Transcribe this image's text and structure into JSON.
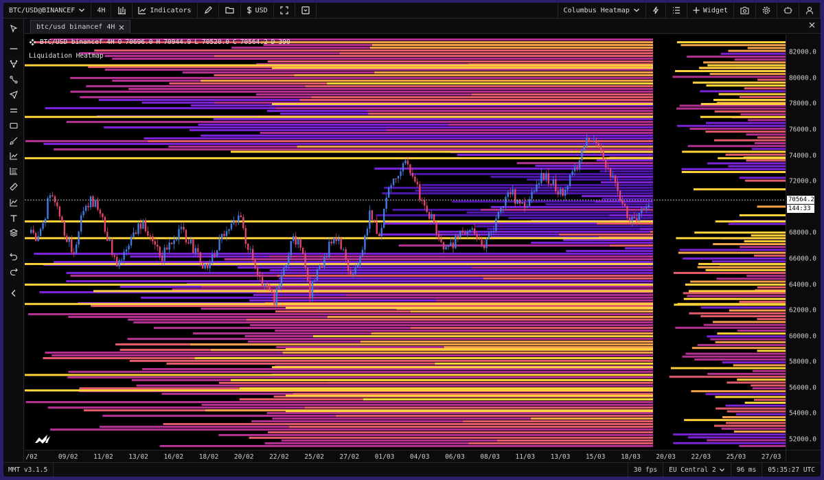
{
  "toolbar": {
    "symbol": "BTC/USD@BINANCEF",
    "interval": "4H",
    "indicators_label": "Indicators",
    "currency_label": "USD",
    "layout_name": "Columbus Heatmap",
    "widget_label": "Widget"
  },
  "tab": {
    "label": "btc/usd binancef 4H"
  },
  "legend": {
    "symbol_text": "BTC/USD binancef 4H",
    "o_label": "O",
    "o_value": "70696.0",
    "h_label": "H",
    "h_value": "70944.9",
    "l_label": "L",
    "l_value": "70520.0",
    "c_label": "C",
    "c_value": "70564.2",
    "d_label": "D",
    "d_value": "390",
    "indicator_name": "Liquidation Heatmap"
  },
  "price_axis": {
    "ticks": [
      "82000.0",
      "80000.0",
      "78000.0",
      "76000.0",
      "74000.0",
      "72000.0",
      "68000.0",
      "66000.0",
      "64000.0",
      "62000.0",
      "60000.0",
      "58000.0",
      "56000.0",
      "54000.0",
      "52000.0"
    ],
    "last_price": "70564.2",
    "countdown": "144:33"
  },
  "time_axis": {
    "ticks": [
      "/02",
      "09/02",
      "11/02",
      "13/02",
      "16/02",
      "18/02",
      "20/02",
      "22/02",
      "25/02",
      "27/02",
      "01/03",
      "04/03",
      "06/03",
      "08/03",
      "11/03",
      "13/03",
      "15/03",
      "18/03",
      "20/03",
      "22/03",
      "25/03",
      "27/03"
    ]
  },
  "status": {
    "version": "MMT v3.1.5",
    "fps": "30 fps",
    "region": "EU Central 2",
    "latency": "96 ms",
    "clock": "05:35:27 UTC"
  },
  "chart_data": {
    "type": "heatmap",
    "title": "Liquidation Heatmap",
    "y_axis_range": [
      51200,
      83400
    ],
    "last_price": 70564.2,
    "ohlc_last": {
      "open": 70696.0,
      "high": 70944.9,
      "low": 70520.0,
      "close": 70564.2
    },
    "candle_colors": {
      "up": "#3f7be0",
      "down": "#e0476a"
    },
    "heat_colors": [
      "#2a0d55",
      "#4b16a6",
      "#7a22d6",
      "#b1308f",
      "#e05a6a",
      "#f5a04a",
      "#ffd23a"
    ],
    "volume_profile_note": "",
    "price_path": [
      68000,
      67600,
      70600,
      70200,
      67400,
      66700,
      69800,
      70600,
      69400,
      67200,
      65600,
      66400,
      68200,
      68600,
      67400,
      66200,
      67000,
      68200,
      67600,
      66400,
      65400,
      66000,
      67800,
      68600,
      69200,
      66800,
      64600,
      63600,
      62800,
      64800,
      67600,
      66900,
      63200,
      65000,
      66600,
      67800,
      66200,
      64600,
      66800,
      69600,
      67800,
      71200,
      72600,
      73800,
      72400,
      70200,
      69200,
      67600,
      66600,
      67600,
      68400,
      67800,
      66600,
      68200,
      70000,
      71400,
      70200,
      69800,
      71600,
      72600,
      71800,
      71000,
      72200,
      73800,
      75600,
      74800,
      73400,
      72000,
      70400,
      68800,
      69600,
      70564
    ]
  }
}
